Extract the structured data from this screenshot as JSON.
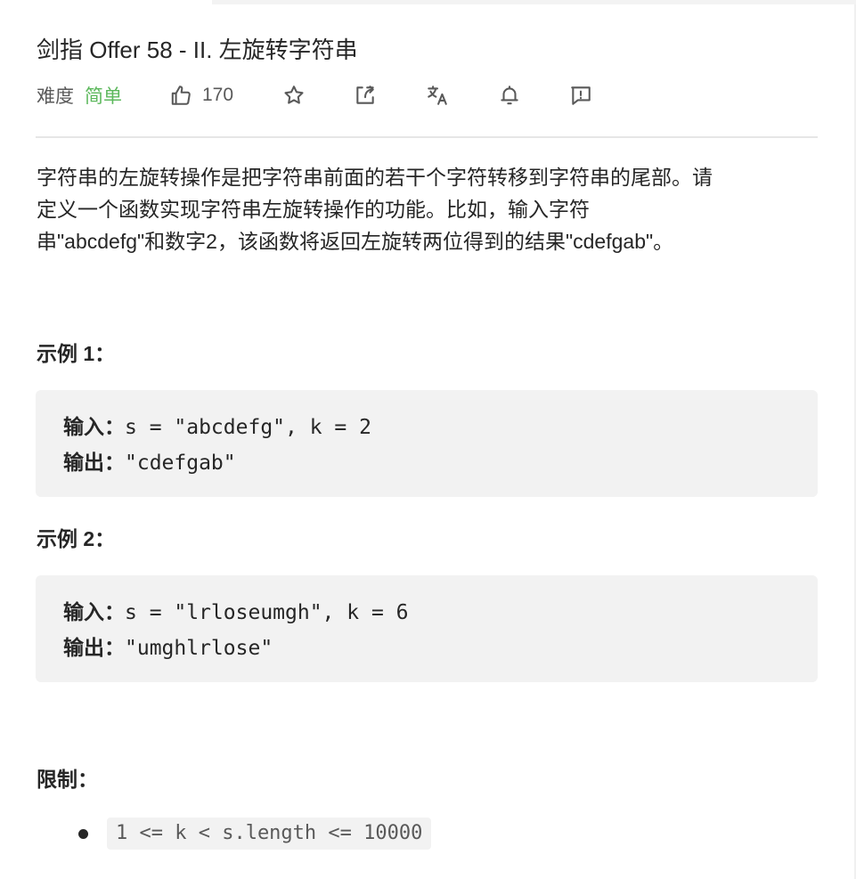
{
  "problem": {
    "title": "剑指 Offer 58 - II. 左旋转字符串",
    "difficulty_label": "难度",
    "difficulty_value": "简单",
    "likes": "170",
    "colors": {
      "difficulty_easy": "#5cb85c",
      "code_bg": "#f2f2f2",
      "text": "#262626",
      "muted": "#595959"
    }
  },
  "toolbar": {
    "icons": [
      "thumbs-up-icon",
      "star-icon",
      "share-icon",
      "translate-icon",
      "bell-icon",
      "feedback-icon"
    ]
  },
  "description": {
    "line1": "字符串的左旋转操作是把字符串前面的若干个字符转移到字符串的尾部。请",
    "line2": "定义一个函数实现字符串左旋转操作的功能。比如，输入字符",
    "line3": "串\"abcdefg\"和数字2，该函数将返回左旋转两位得到的结果\"cdefgab\"。"
  },
  "examples": [
    {
      "heading": "示例 1：",
      "input_label": "输入：",
      "input_value": "s = \"abcdefg\", k = 2",
      "output_label": "输出：",
      "output_value": "\"cdefgab\""
    },
    {
      "heading": "示例 2：",
      "input_label": "输入：",
      "input_value": "s = \"lrloseumgh\", k = 6",
      "output_label": "输出：",
      "output_value": "\"umghlrlose\""
    }
  ],
  "constraints": {
    "heading": "限制：",
    "items": [
      "1 <= k < s.length <= 10000"
    ]
  }
}
